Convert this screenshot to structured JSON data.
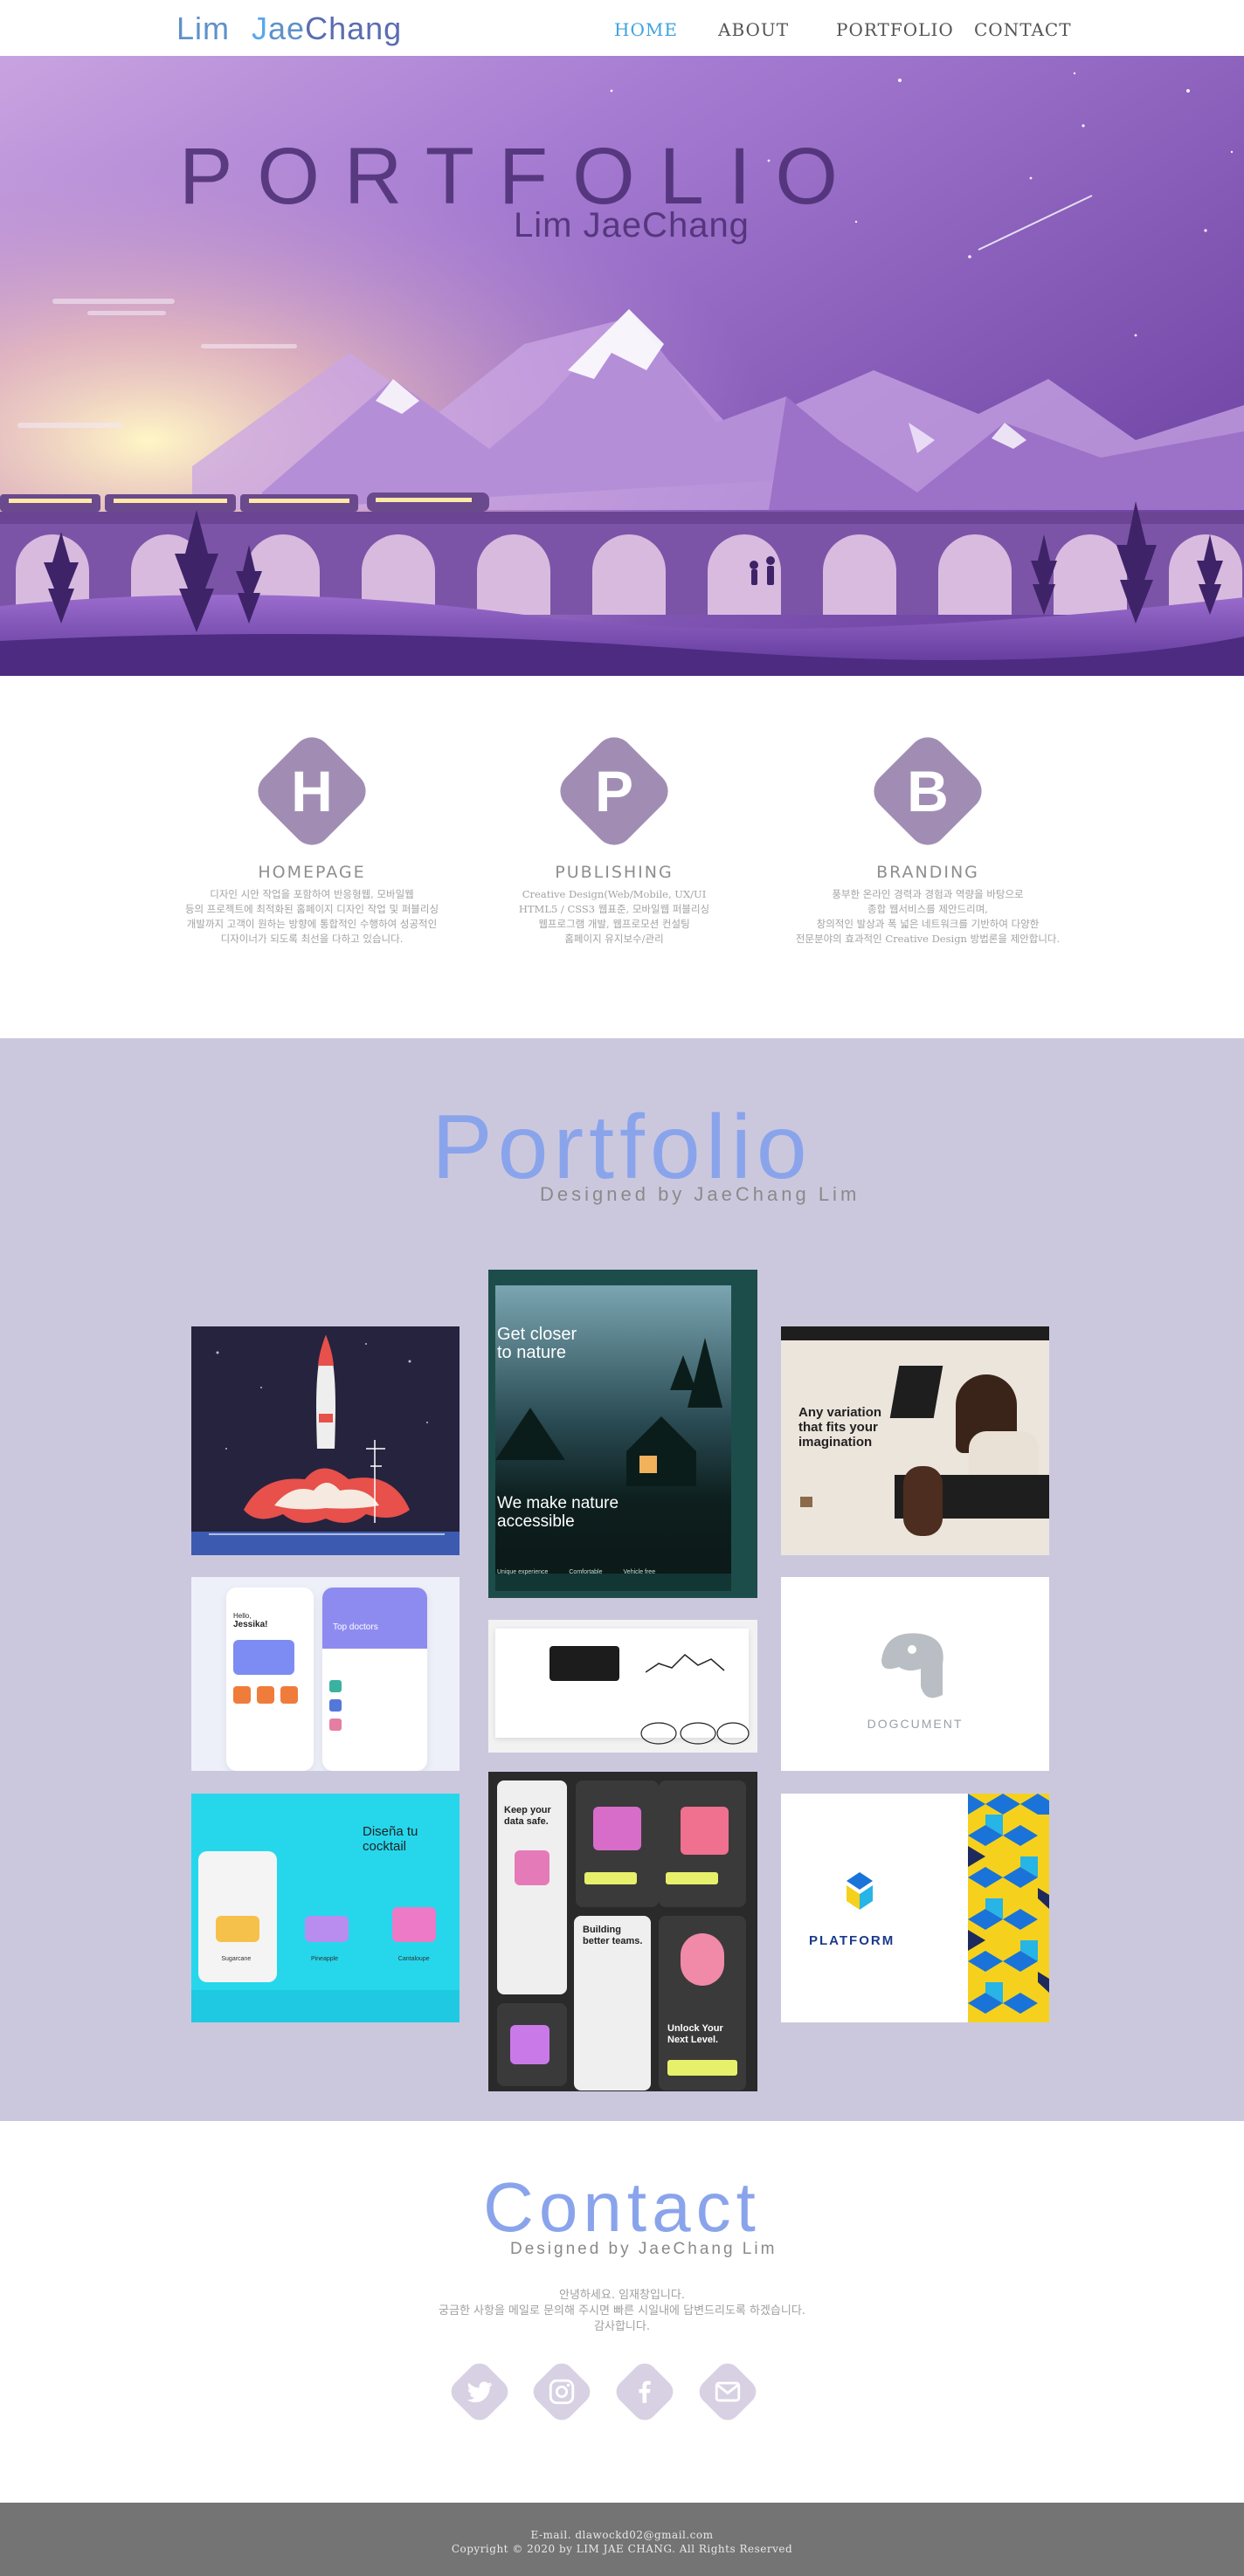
{
  "nav": {
    "logo": {
      "first": "Lim",
      "j": "J",
      "ae": "ae",
      "chang": "Chang"
    },
    "items": [
      {
        "label": "HOME",
        "active": true
      },
      {
        "label": "ABOUT",
        "active": false
      },
      {
        "label": "PORTFOLIO",
        "active": false
      },
      {
        "label": "CONTACT",
        "active": false
      }
    ]
  },
  "hero": {
    "title": "PORTFOLIO",
    "subtitle": "Lim JaeChang"
  },
  "services": [
    {
      "letter": "H",
      "title": "HOMEPAGE",
      "desc": "디자인 시안 작업을 포함하여 반응형웹, 모바일웹\n등의 프로젝트에 최적화된 홈페이지 디자인 작업 및 퍼블리싱\n개발까지 고객이 원하는 방향에 통합적인 수행하여 성공적인\n디자이너가 되도록 최선을 다하고 있습니다."
    },
    {
      "letter": "P",
      "title": "PUBLISHING",
      "desc": "Creative Design(Web/Mobile, UX/UI\nHTML5 / CSS3 웹표준, 모바일웹 퍼블리싱\n웹프로그램 개발, 웹프로모션 컨설팅\n홈페이지 유지보수/관리"
    },
    {
      "letter": "B",
      "title": "BRANDING",
      "desc": "풍부한 온라인 경력과 경험과 역량을 바탕으로\n종합 웹서비스를 제안드리며,\n창의적인 발상과 폭 넓은 네트워크를 기반하여 다양한\n전문분야의 효과적인 Creative Design 방법론을 제안합니다."
    }
  ],
  "portfolio": {
    "title": "Portfolio",
    "subtitle": "Designed by JaeChang Lim",
    "thumbs": [
      {
        "name": "rocket-launch-illustration"
      },
      {
        "name": "nature-website-mockup",
        "text": [
          "Get closer",
          "to nature",
          "We make nature",
          "accessible",
          "Unique experience",
          "Comfortable",
          "Vehicle free"
        ]
      },
      {
        "name": "fashion-website-mockup",
        "text": [
          "Any variation",
          "that fits your",
          "imagination"
        ]
      },
      {
        "name": "doctor-app-mockup",
        "text": [
          "Hello,",
          "Jessika!",
          "Top doctors"
        ]
      },
      {
        "name": "dashboard-mockup"
      },
      {
        "name": "dogcument-logo",
        "text": [
          "DOGCUMENT"
        ]
      },
      {
        "name": "cocktail-app-mockup",
        "text": [
          "Diseña tu",
          "cocktail",
          "Sugarcane",
          "Pineapple",
          "Cantaloupe"
        ]
      },
      {
        "name": "security-app-mockup",
        "text": [
          "Keep your",
          "data safe.",
          "Building",
          "better teams.",
          "Unlock Your",
          "Next Level."
        ]
      },
      {
        "name": "platform-logo",
        "text": [
          "PLATFORM"
        ]
      }
    ]
  },
  "contact": {
    "title": "Contact",
    "subtitle": "Designed by JaeChang Lim",
    "message": [
      "안녕하세요. 임재창입니다.",
      "궁금한 사항을 메일로 문의해 주시면 빠른 시일내에 답변드리도록 하겠습니다.",
      "감사합니다."
    ],
    "icons": [
      "twitter-icon",
      "instagram-icon",
      "facebook-icon",
      "mail-icon"
    ]
  },
  "footer": {
    "email": "E-mail. dlawockd02@gmail.com",
    "copyright": "Copyright © 2020 by LIM JAE CHANG. All Rights Reserved"
  },
  "colors": {
    "accent": "#8aa4ec",
    "diamond": "#a18db4",
    "section_bg": "#cbc8de",
    "footer_bg": "#747474"
  }
}
